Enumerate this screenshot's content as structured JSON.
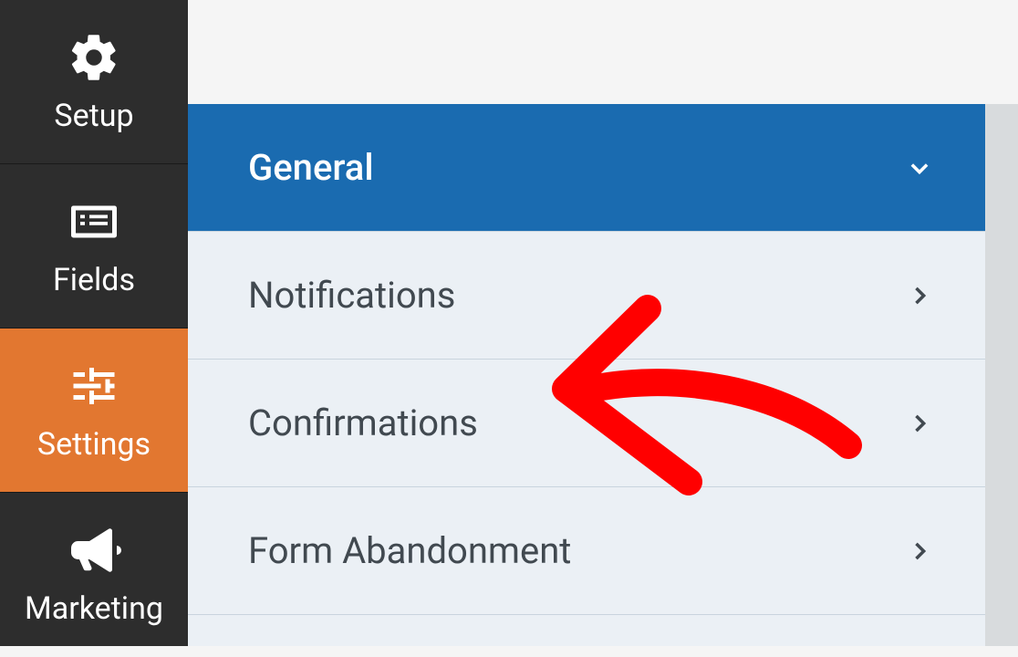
{
  "sidebar": {
    "items": [
      {
        "label": "Setup"
      },
      {
        "label": "Fields"
      },
      {
        "label": "Settings"
      },
      {
        "label": "Marketing"
      }
    ]
  },
  "settings": {
    "rows": [
      {
        "label": "General"
      },
      {
        "label": "Notifications"
      },
      {
        "label": "Confirmations"
      },
      {
        "label": "Form Abandonment"
      }
    ]
  },
  "annotation": {
    "color": "#ff0000"
  }
}
